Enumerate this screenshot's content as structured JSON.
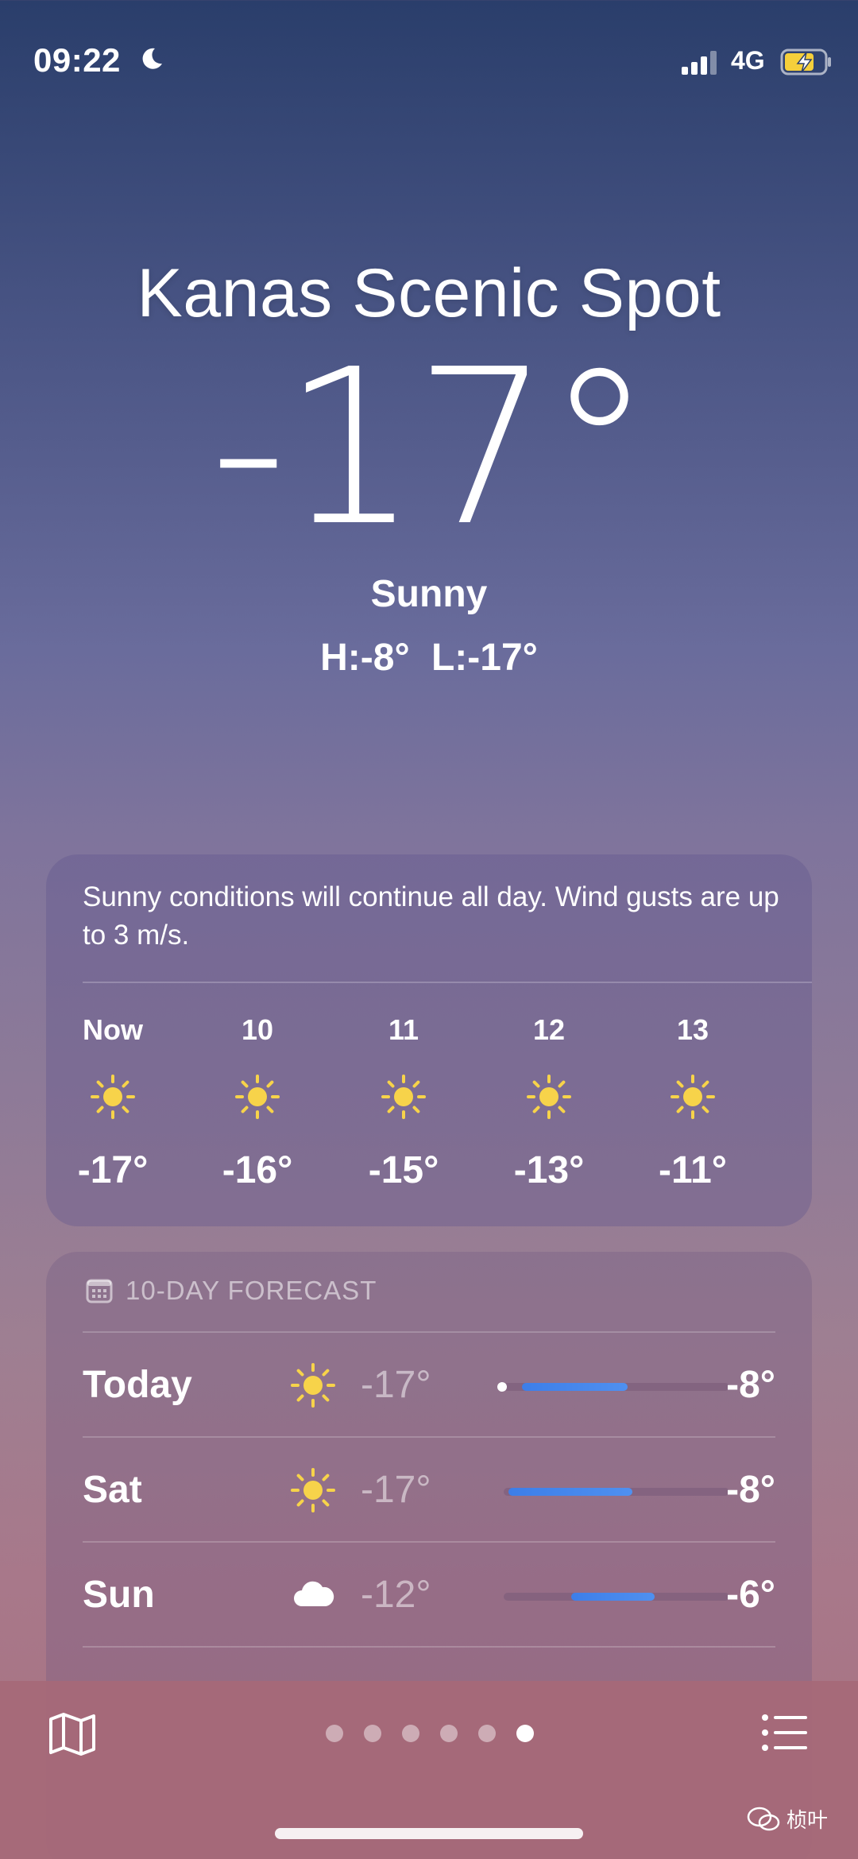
{
  "status_bar": {
    "time": "09:22",
    "network": "4G"
  },
  "location": {
    "city": "Kanas Scenic Spot",
    "temperature": "-17°",
    "condition": "Sunny",
    "high_low": "H:-8° L:-17°"
  },
  "hourly": {
    "summary": "Sunny conditions will continue all day. Wind gusts are up to 3 m/s.",
    "items": [
      {
        "label": "Now",
        "icon": "sun-icon",
        "temp": "-17°"
      },
      {
        "label": "10",
        "icon": "sun-icon",
        "temp": "-16°"
      },
      {
        "label": "11",
        "icon": "sun-icon",
        "temp": "-15°"
      },
      {
        "label": "12",
        "icon": "sun-icon",
        "temp": "-13°"
      },
      {
        "label": "13",
        "icon": "sun-icon",
        "temp": "-11°"
      }
    ]
  },
  "forecast": {
    "title": "10-DAY FORECAST",
    "days": [
      {
        "day": "Today",
        "icon": "sun-icon",
        "low": "-17°",
        "high": "-8°",
        "range_start": 0.08,
        "range_end": 0.55,
        "current_marker": 0.0
      },
      {
        "day": "Sat",
        "icon": "sun-icon",
        "low": "-17°",
        "high": "-8°",
        "range_start": 0.02,
        "range_end": 0.57
      },
      {
        "day": "Sun",
        "icon": "cloud-icon",
        "low": "-12°",
        "high": "-6°",
        "range_start": 0.3,
        "range_end": 0.67
      }
    ]
  },
  "pager": {
    "page_count": 6,
    "active_page": 6
  },
  "watermark": "桢叶",
  "colors": {
    "sun": "#f7d34a",
    "range_bar": "#4a88ee"
  }
}
